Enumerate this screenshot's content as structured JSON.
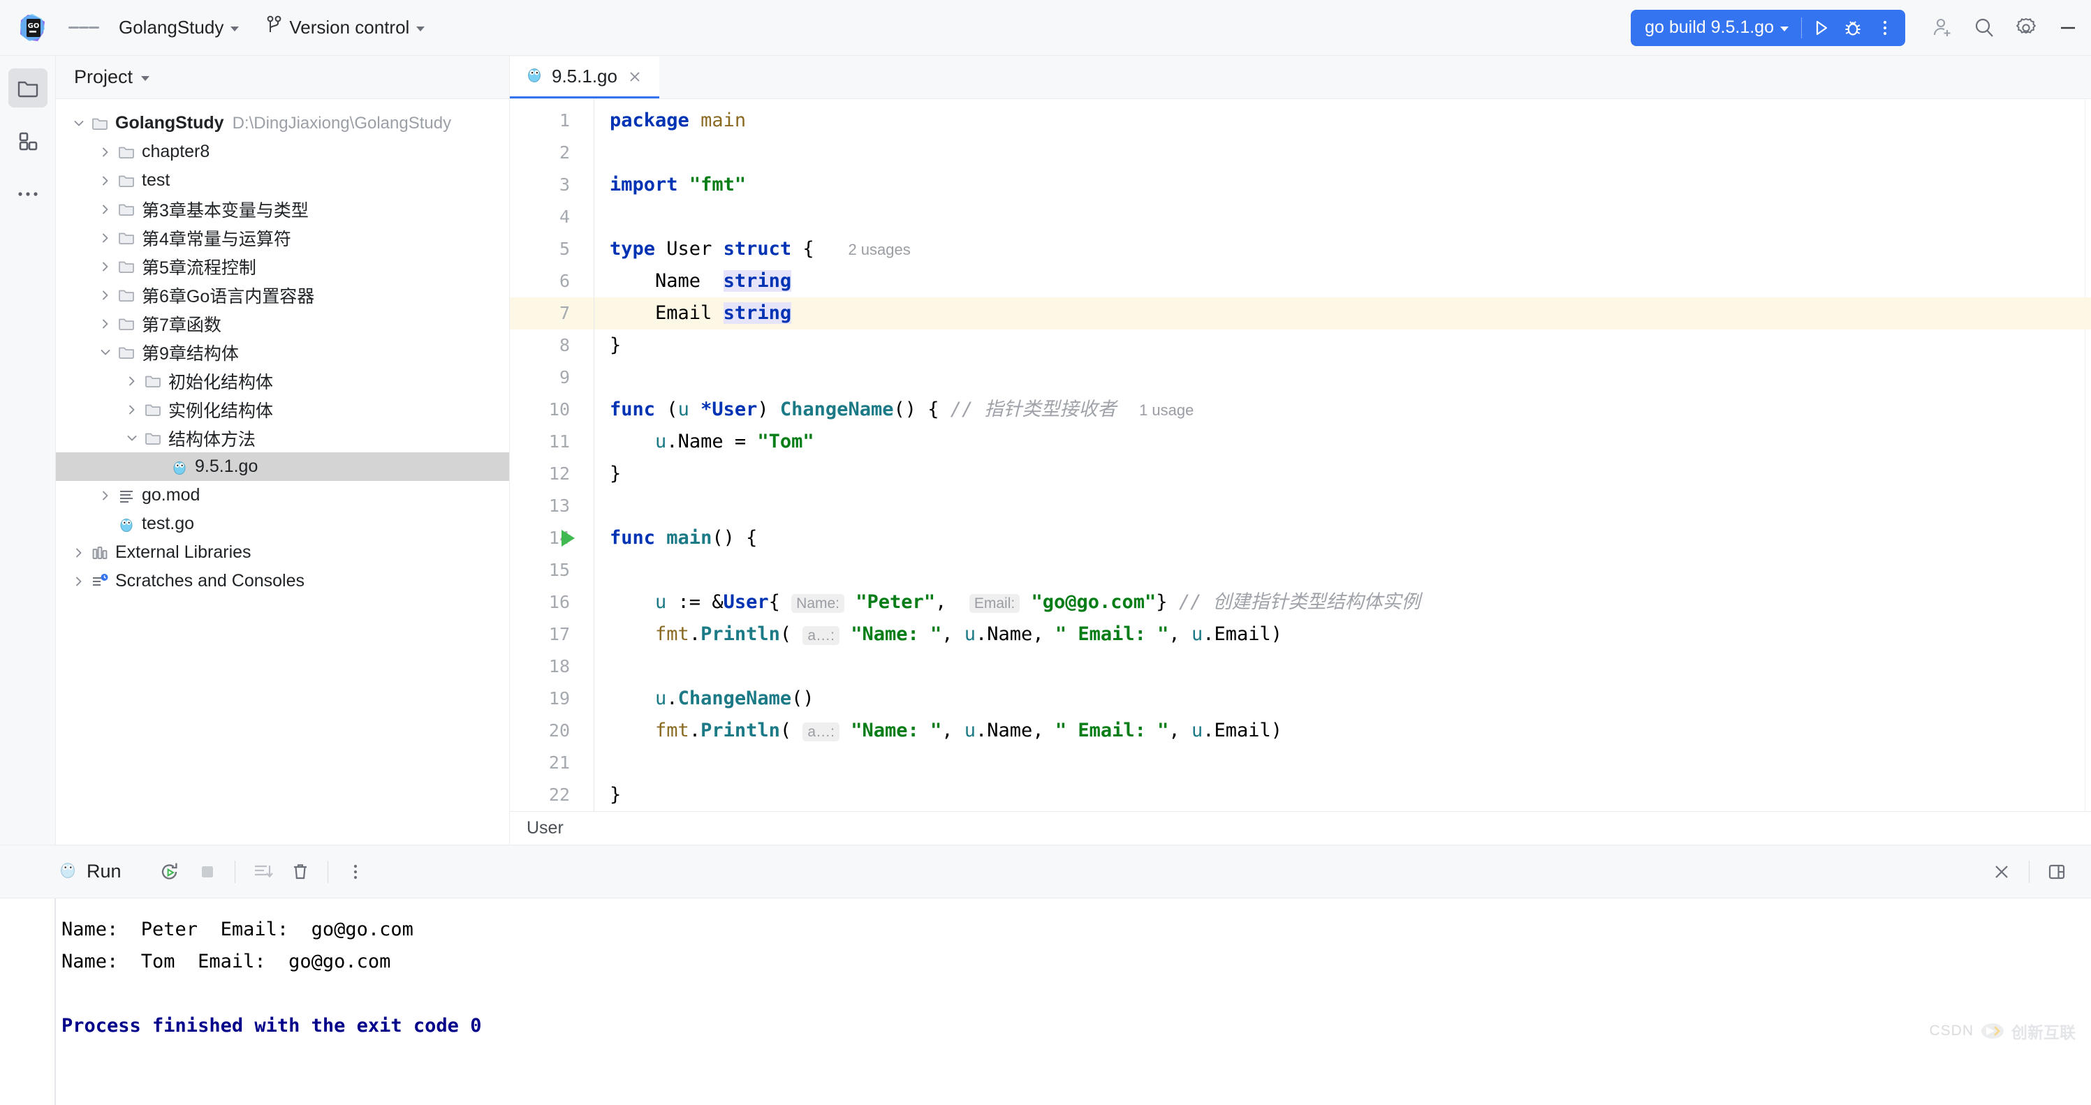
{
  "toolbar": {
    "app_logo": "goland-logo",
    "menu_label": "main-menu",
    "project_name": "GolangStudy",
    "vcs_label": "Version control",
    "run_config": "go build 9.5.1.go",
    "run_button": "run-icon",
    "debug_button": "debug-icon",
    "more_button": "more-vertical-icon",
    "account_icon": "add-account-icon",
    "search_icon": "search-icon",
    "settings_icon": "gear-icon",
    "minimize_icon": "minimize-icon"
  },
  "activity_bar": {
    "items": [
      {
        "name": "project",
        "icon": "folder-icon",
        "active": true
      },
      {
        "name": "structure",
        "icon": "blocks-icon",
        "active": false
      },
      {
        "name": "more",
        "icon": "more-horizontal-icon",
        "active": false
      }
    ]
  },
  "project_panel": {
    "title": "Project",
    "tree": [
      {
        "label": "GolangStudy",
        "path": "D:\\DingJiaxiong\\GolangStudy",
        "indent": 0,
        "arrow": "down",
        "icon": "folder",
        "bold": true
      },
      {
        "label": "chapter8",
        "path": "",
        "indent": 1,
        "arrow": "right",
        "icon": "folder",
        "bold": false
      },
      {
        "label": "test",
        "path": "",
        "indent": 1,
        "arrow": "right",
        "icon": "folder",
        "bold": false
      },
      {
        "label": "第3章基本变量与类型",
        "path": "",
        "indent": 1,
        "arrow": "right",
        "icon": "folder",
        "bold": false
      },
      {
        "label": "第4章常量与运算符",
        "path": "",
        "indent": 1,
        "arrow": "right",
        "icon": "folder",
        "bold": false
      },
      {
        "label": "第5章流程控制",
        "path": "",
        "indent": 1,
        "arrow": "right",
        "icon": "folder",
        "bold": false
      },
      {
        "label": "第6章Go语言内置容器",
        "path": "",
        "indent": 1,
        "arrow": "right",
        "icon": "folder",
        "bold": false
      },
      {
        "label": "第7章函数",
        "path": "",
        "indent": 1,
        "arrow": "right",
        "icon": "folder",
        "bold": false
      },
      {
        "label": "第9章结构体",
        "path": "",
        "indent": 1,
        "arrow": "down",
        "icon": "folder",
        "bold": false
      },
      {
        "label": "初始化结构体",
        "path": "",
        "indent": 2,
        "arrow": "right",
        "icon": "folder",
        "bold": false
      },
      {
        "label": "实例化结构体",
        "path": "",
        "indent": 2,
        "arrow": "right",
        "icon": "folder",
        "bold": false
      },
      {
        "label": "结构体方法",
        "path": "",
        "indent": 2,
        "arrow": "down",
        "icon": "folder",
        "bold": false
      },
      {
        "label": "9.5.1.go",
        "path": "",
        "indent": 3,
        "arrow": "none",
        "icon": "go",
        "bold": false,
        "selected": true
      },
      {
        "label": "go.mod",
        "path": "",
        "indent": 1,
        "arrow": "right",
        "icon": "gomod",
        "bold": false
      },
      {
        "label": "test.go",
        "path": "",
        "indent": 1,
        "arrow": "none",
        "icon": "go",
        "bold": false
      },
      {
        "label": "External Libraries",
        "path": "",
        "indent": 0,
        "arrow": "right",
        "icon": "library",
        "bold": false
      },
      {
        "label": "Scratches and Consoles",
        "path": "",
        "indent": 0,
        "arrow": "right",
        "icon": "scratches",
        "bold": false
      }
    ]
  },
  "editor": {
    "tabs": [
      {
        "label": "9.5.1.go",
        "icon": "go-file-icon",
        "active": true
      }
    ],
    "caret_line": 7,
    "run_marker_line": 14,
    "total_lines": 23,
    "breadcrumb": "User",
    "inlay_hints": {
      "struct_usages": "2 usages",
      "func_usage": "1 usage",
      "name_param": "Name:",
      "email_param": "Email:",
      "varargs": "a…:"
    },
    "comments": {
      "pointer_receiver": "// 指针类型接收者",
      "create_instance": "// 创建指针类型结构体实例"
    },
    "code_text": "package main\n\nimport \"fmt\"\n\ntype User struct {   2 usages\n    Name  string\n    Email string\n}\n\nfunc (u *User) ChangeName() { // 指针类型接收者  1 usage\n    u.Name = \"Tom\"\n}\n\nfunc main() {\n\n    u := &User{ Name: \"Peter\",  Email: \"go@go.com\"} // 创建指针类型结构体实例\n    fmt.Println( a…: \"Name: \", u.Name, \" Email: \", u.Email)\n\n    u.ChangeName()\n    fmt.Println( a…: \"Name: \", u.Name, \" Email: \", u.Email)\n\n}\n"
  },
  "run_window": {
    "title": "Run",
    "icon": "go-run-icon",
    "buttons": {
      "rerun": "rerun-icon",
      "stop": "stop-icon",
      "scroll_to_end": "scroll-to-end-icon",
      "clear": "trash-icon",
      "more": "more-vertical-icon",
      "close": "close-icon",
      "layout": "layout-settings-icon"
    },
    "console": [
      {
        "text": "Name:  Peter  Email:  go@go.com",
        "style": "normal"
      },
      {
        "text": "Name:  Tom  Email:  go@go.com",
        "style": "normal"
      },
      {
        "text": "",
        "style": "normal"
      },
      {
        "text": "Process finished with the exit code 0",
        "style": "exit"
      }
    ]
  },
  "watermark": {
    "brand": "CSDN",
    "text": "创新互联"
  },
  "colors": {
    "accent": "#3574f0",
    "keyword": "#0033b3",
    "string": "#067d17",
    "function": "#1b7a86",
    "package": "#8a6a22",
    "comment": "#9fa3a9",
    "caret_line": "#fdf8e6",
    "exit_code": "#00008b"
  }
}
